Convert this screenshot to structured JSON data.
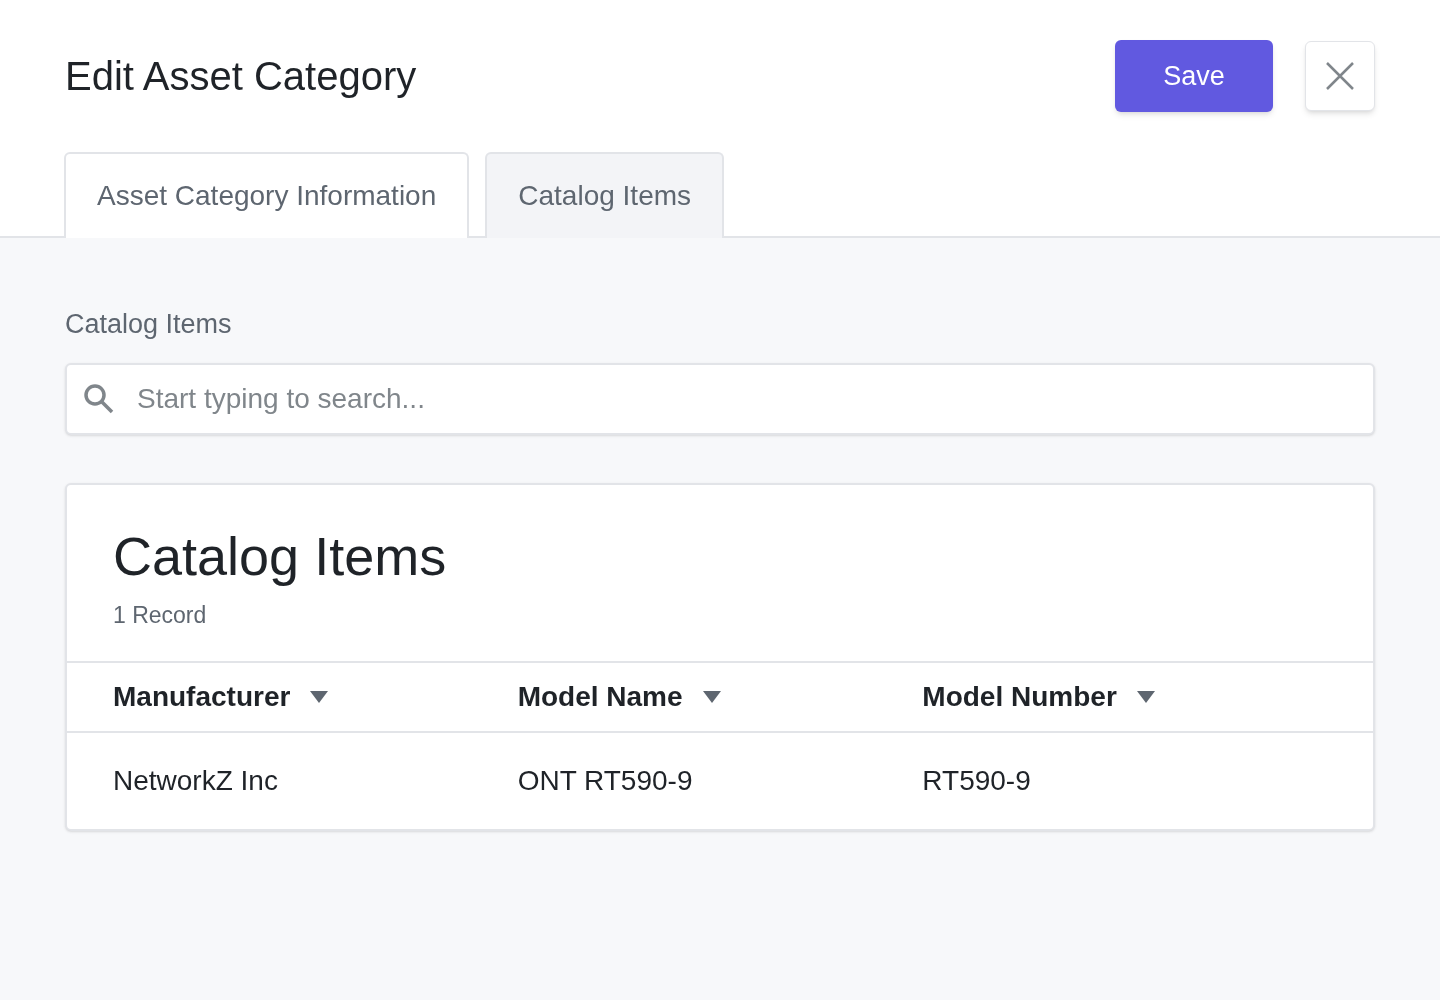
{
  "window": {
    "title": "Edit Asset Category"
  },
  "save_button": "Save",
  "tabs": [
    {
      "label": "Asset Category Information",
      "selected": false
    },
    {
      "label": "Catalog Items",
      "selected": true
    }
  ],
  "section_label": "Catalog Items",
  "search": {
    "placeholder": "Start typing to search..."
  },
  "table": {
    "title": "Catalog Items",
    "count": "1 Record",
    "columns": [
      "Manufacturer",
      "Model Name",
      "Model Number"
    ],
    "rows": [
      [
        "NetworkZ Inc",
        "ONT RT590-9",
        "RT590-9"
      ]
    ]
  }
}
